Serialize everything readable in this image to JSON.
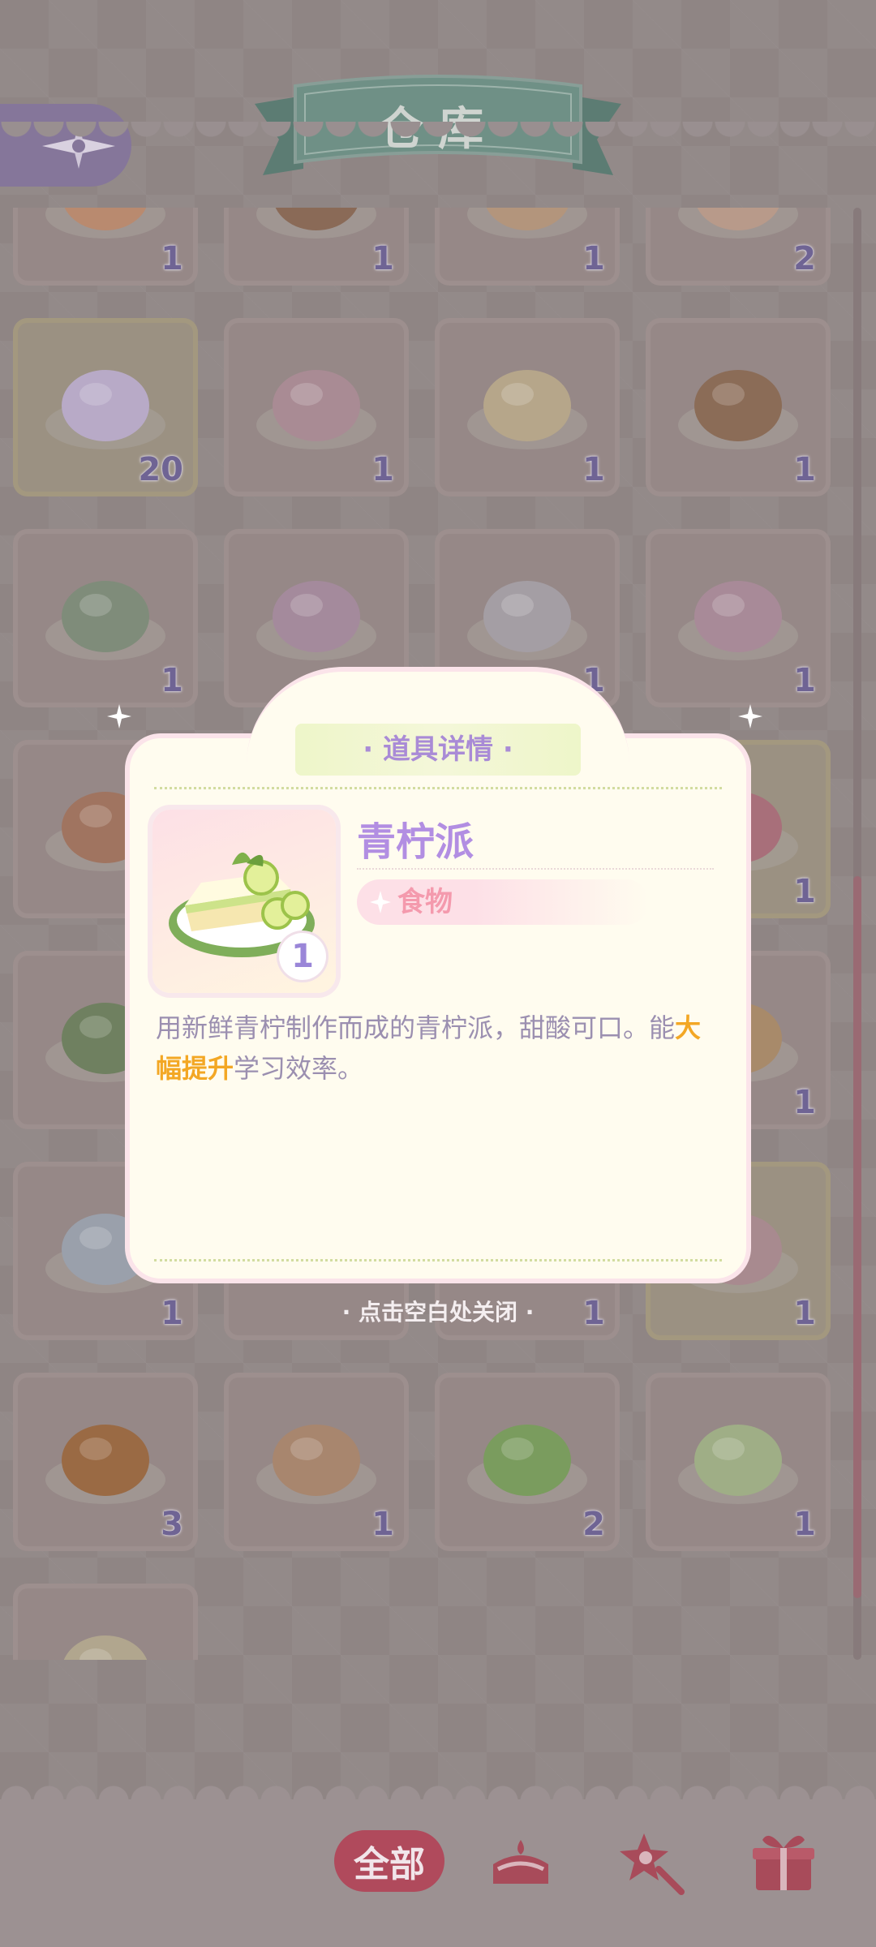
{
  "header": {
    "title": "仓库",
    "back_icon": "compass-back-icon"
  },
  "grid": {
    "rows": [
      [
        {
          "count": "1",
          "gold": false,
          "icon": "pizza-plate-icon"
        },
        {
          "count": "1",
          "gold": false,
          "icon": "scroll-roll-icon"
        },
        {
          "count": "1",
          "gold": false,
          "icon": "sandwich-plate-icon"
        },
        {
          "count": "2",
          "gold": false,
          "icon": "soup-bowl-icon"
        }
      ],
      [
        {
          "count": "20",
          "gold": true,
          "icon": "paper-crane-icon"
        },
        {
          "count": "1",
          "gold": false,
          "icon": "puzzle-ticket-icon"
        },
        {
          "count": "1",
          "gold": false,
          "icon": "broth-bowl-icon"
        },
        {
          "count": "1",
          "gold": false,
          "icon": "fish-icon"
        }
      ],
      [
        {
          "count": "1",
          "gold": false,
          "icon": "scissors-icon"
        },
        {
          "count": "",
          "gold": false,
          "icon": "mirror-icon"
        },
        {
          "count": "1",
          "gold": false,
          "icon": "newspaper-icon"
        },
        {
          "count": "1",
          "gold": false,
          "icon": "art-book-icon"
        }
      ],
      [
        {
          "count": "",
          "gold": false,
          "icon": "sandwich-icon"
        },
        {
          "count": "",
          "gold": false,
          "icon": ""
        },
        {
          "count": "",
          "gold": false,
          "icon": ""
        },
        {
          "count": "1",
          "gold": true,
          "icon": "badge-icon"
        }
      ],
      [
        {
          "count": "",
          "gold": false,
          "icon": "salad-icon"
        },
        {
          "count": "",
          "gold": false,
          "icon": ""
        },
        {
          "count": "",
          "gold": false,
          "icon": ""
        },
        {
          "count": "1",
          "gold": false,
          "icon": "dessert-icon"
        }
      ],
      [
        {
          "count": "1",
          "gold": false,
          "icon": "book-icon"
        },
        {
          "count": "",
          "gold": false,
          "icon": ""
        },
        {
          "count": "1",
          "gold": false,
          "icon": ""
        },
        {
          "count": "1",
          "gold": true,
          "icon": "photo-cards-icon"
        }
      ],
      [
        {
          "count": "3",
          "gold": false,
          "icon": "fried-chicken-icon"
        },
        {
          "count": "1",
          "gold": false,
          "icon": "hotdog-icon"
        },
        {
          "count": "2",
          "gold": false,
          "icon": "wrap-icon"
        },
        {
          "count": "1",
          "gold": false,
          "icon": "lime-pie-icon"
        }
      ],
      [
        {
          "count": "",
          "gold": false,
          "icon": "plate-icon"
        }
      ]
    ]
  },
  "dialog": {
    "title": "道具详情",
    "item_name": "青柠派",
    "item_count": "1",
    "category": "食物",
    "desc_part1": "用新鲜青柠制作而成的青柠派，甜酸可口。能",
    "desc_highlight": "大幅提升",
    "desc_part2": "学习效率。",
    "close_hint": "· 点击空白处关闭 ·"
  },
  "tabs": {
    "all_label": "全部",
    "icons": [
      "cake-tab-icon",
      "wand-tab-icon",
      "gift-tab-icon"
    ]
  },
  "colors": {
    "accent": "#b28ee2",
    "highlight": "#f3a724",
    "tab_active": "#b04a5c"
  }
}
